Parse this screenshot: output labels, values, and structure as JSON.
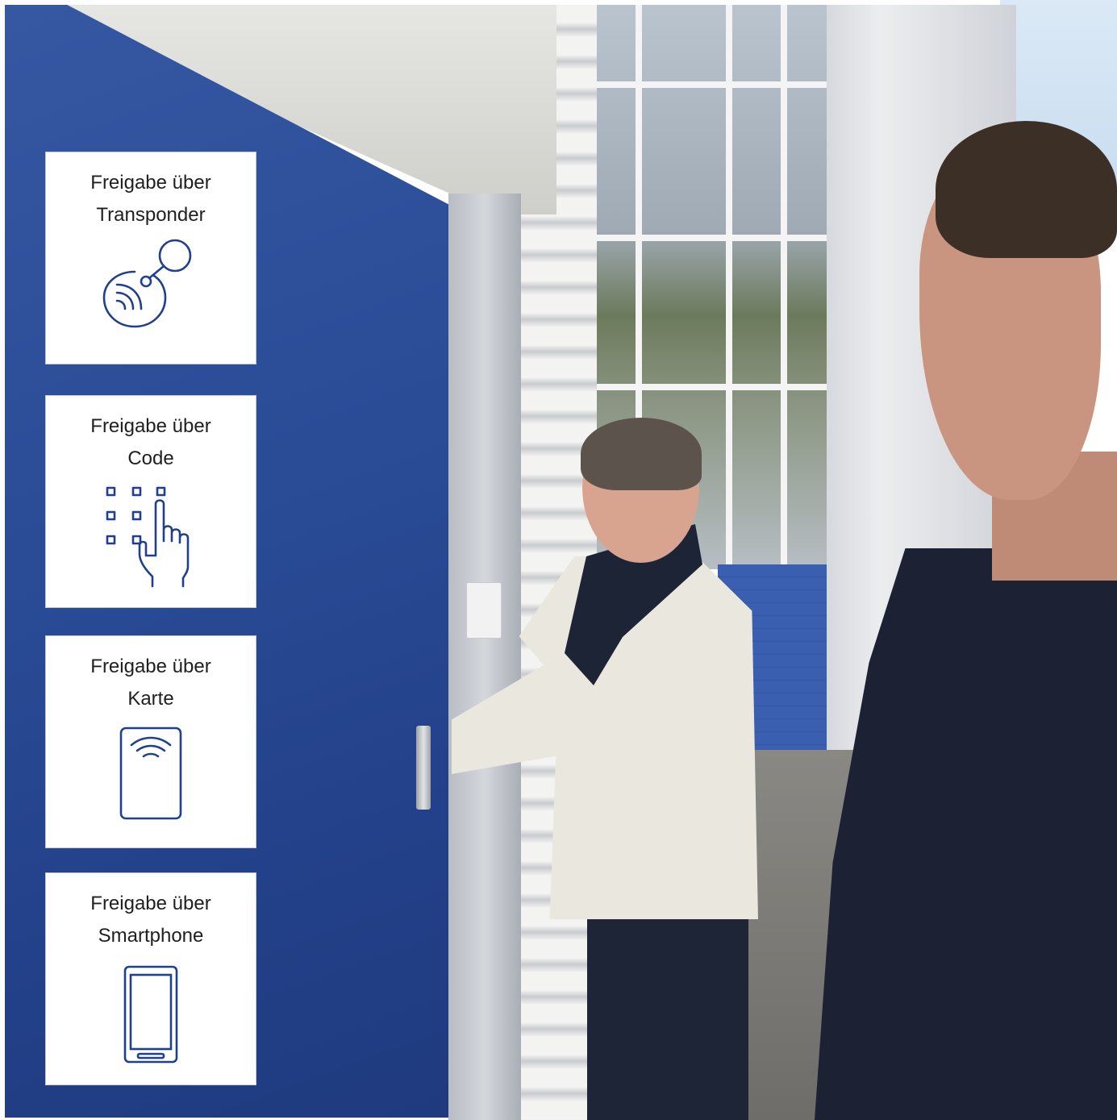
{
  "cards": [
    {
      "line1": "Freigabe über",
      "line2": "Transponder",
      "icon": "transponder-icon"
    },
    {
      "line1": "Freigabe über",
      "line2": "Code",
      "icon": "keypad-touch-icon"
    },
    {
      "line1": "Freigabe über",
      "line2": "Karte",
      "icon": "card-icon"
    },
    {
      "line1": "Freigabe über",
      "line2": "Smartphone",
      "icon": "smartphone-icon"
    }
  ],
  "colors": {
    "icon_blue": "#1f3f8f",
    "door_blue": "#2b4d98",
    "card_border": "#c7c9cd"
  }
}
